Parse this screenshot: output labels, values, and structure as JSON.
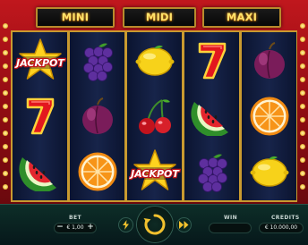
{
  "jackpots": [
    {
      "label": "MINI JACKPOT"
    },
    {
      "label": "MIDI JACKPOT"
    },
    {
      "label": "MAXI JACKPOT"
    }
  ],
  "reels": [
    [
      "jackpot-star",
      "seven",
      "watermelon"
    ],
    [
      "grapes",
      "plum",
      "orange"
    ],
    [
      "lemon",
      "cherries",
      "jackpot-star"
    ],
    [
      "seven",
      "watermelon",
      "grapes"
    ],
    [
      "plum",
      "orange",
      "lemon"
    ]
  ],
  "symbol_text": {
    "jackpot": "JACKPOT"
  },
  "controls": {
    "bet_label": "BET",
    "bet_value": "€ 1,00",
    "bet_minus": "−",
    "bet_plus": "+",
    "win_label": "WIN",
    "win_value": "",
    "credits_label": "CREDITS",
    "credits_value": "€ 10.000,00"
  },
  "icons": {
    "turbo": "lightning-icon",
    "spin": "spin-arrow-icon",
    "autoplay": "fast-forward-icon"
  },
  "colors": {
    "banner_text": "#ffe36b",
    "frame_gold": "#c99a2f",
    "bar_bg": "#0d2e28",
    "spin_accent": "#f2c12e"
  }
}
